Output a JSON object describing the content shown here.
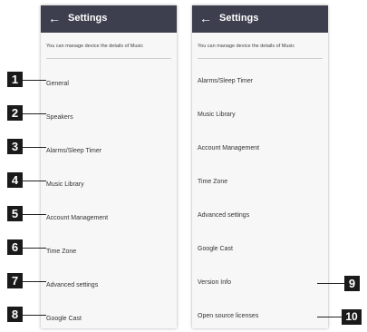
{
  "screens": {
    "left": {
      "title": "Settings",
      "subtitle": "You can manage device the details of Music",
      "items": [
        "General",
        "Speakers",
        "Alarms/Sleep Timer",
        "Music Library",
        "Account Management",
        "Time Zone",
        "Advanced settings",
        "Google Cast"
      ]
    },
    "right": {
      "title": "Settings",
      "subtitle": "You can manage device the details of Music",
      "items": [
        "Alarms/Sleep Timer",
        "Music Library",
        "Account Management",
        "Time Zone",
        "Advanced settings",
        "Google Cast",
        "Version Info",
        "Open source licenses"
      ]
    }
  },
  "callouts": [
    "1",
    "2",
    "3",
    "4",
    "5",
    "6",
    "7",
    "8",
    "9",
    "10"
  ],
  "colors": {
    "appbar": "#3d3f4f",
    "marker": "#1a1a1a",
    "background": "#ffffff"
  }
}
